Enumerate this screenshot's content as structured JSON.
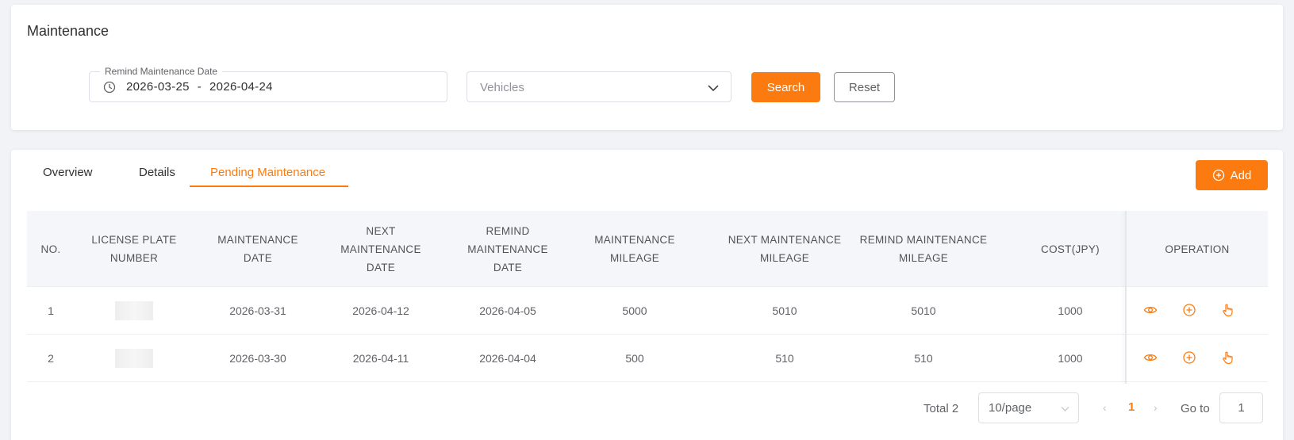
{
  "filter": {
    "title": "Maintenance",
    "date_label": "Remind Maintenance Date",
    "date_start": "2026-03-25",
    "date_separator": "-",
    "date_end": "2026-04-24",
    "vehicle_placeholder": "Vehicles",
    "search_label": "Search",
    "reset_label": "Reset"
  },
  "tabs": [
    {
      "label": "Overview",
      "active": false
    },
    {
      "label": "Details",
      "active": false
    },
    {
      "label": "Pending Maintenance",
      "active": true
    }
  ],
  "add_label": "Add",
  "table": {
    "headers": [
      "NO.",
      "LICENSE PLATE NUMBER",
      "MAINTENANCE DATE",
      "NEXT MAINTENANCE DATE",
      "REMIND MAINTENANCE DATE",
      "MAINTENANCE MILEAGE",
      "NEXT MAINTENANCE MILEAGE",
      "REMIND MAINTENANCE MILEAGE",
      "COST(JPY)",
      "OPERATION"
    ],
    "rows": [
      {
        "no": "1",
        "maintenance_date": "2026-03-31",
        "next_date": "2026-04-12",
        "remind_date": "2026-04-05",
        "mileage": "5000",
        "next_mileage": "5010",
        "remind_mileage": "5010",
        "cost": "1000"
      },
      {
        "no": "2",
        "maintenance_date": "2026-03-30",
        "next_date": "2026-04-11",
        "remind_date": "2026-04-04",
        "mileage": "500",
        "next_mileage": "510",
        "remind_mileage": "510",
        "cost": "1000"
      }
    ],
    "operation_icons": [
      "eye-icon",
      "plus-circle-icon",
      "hand-pointer-icon"
    ]
  },
  "pagination": {
    "total_label": "Total 2",
    "page_size": "10/page",
    "current_page": "1",
    "goto_label": "Go to",
    "goto_value": "1"
  },
  "colors": {
    "accent": "#fb7b10"
  }
}
